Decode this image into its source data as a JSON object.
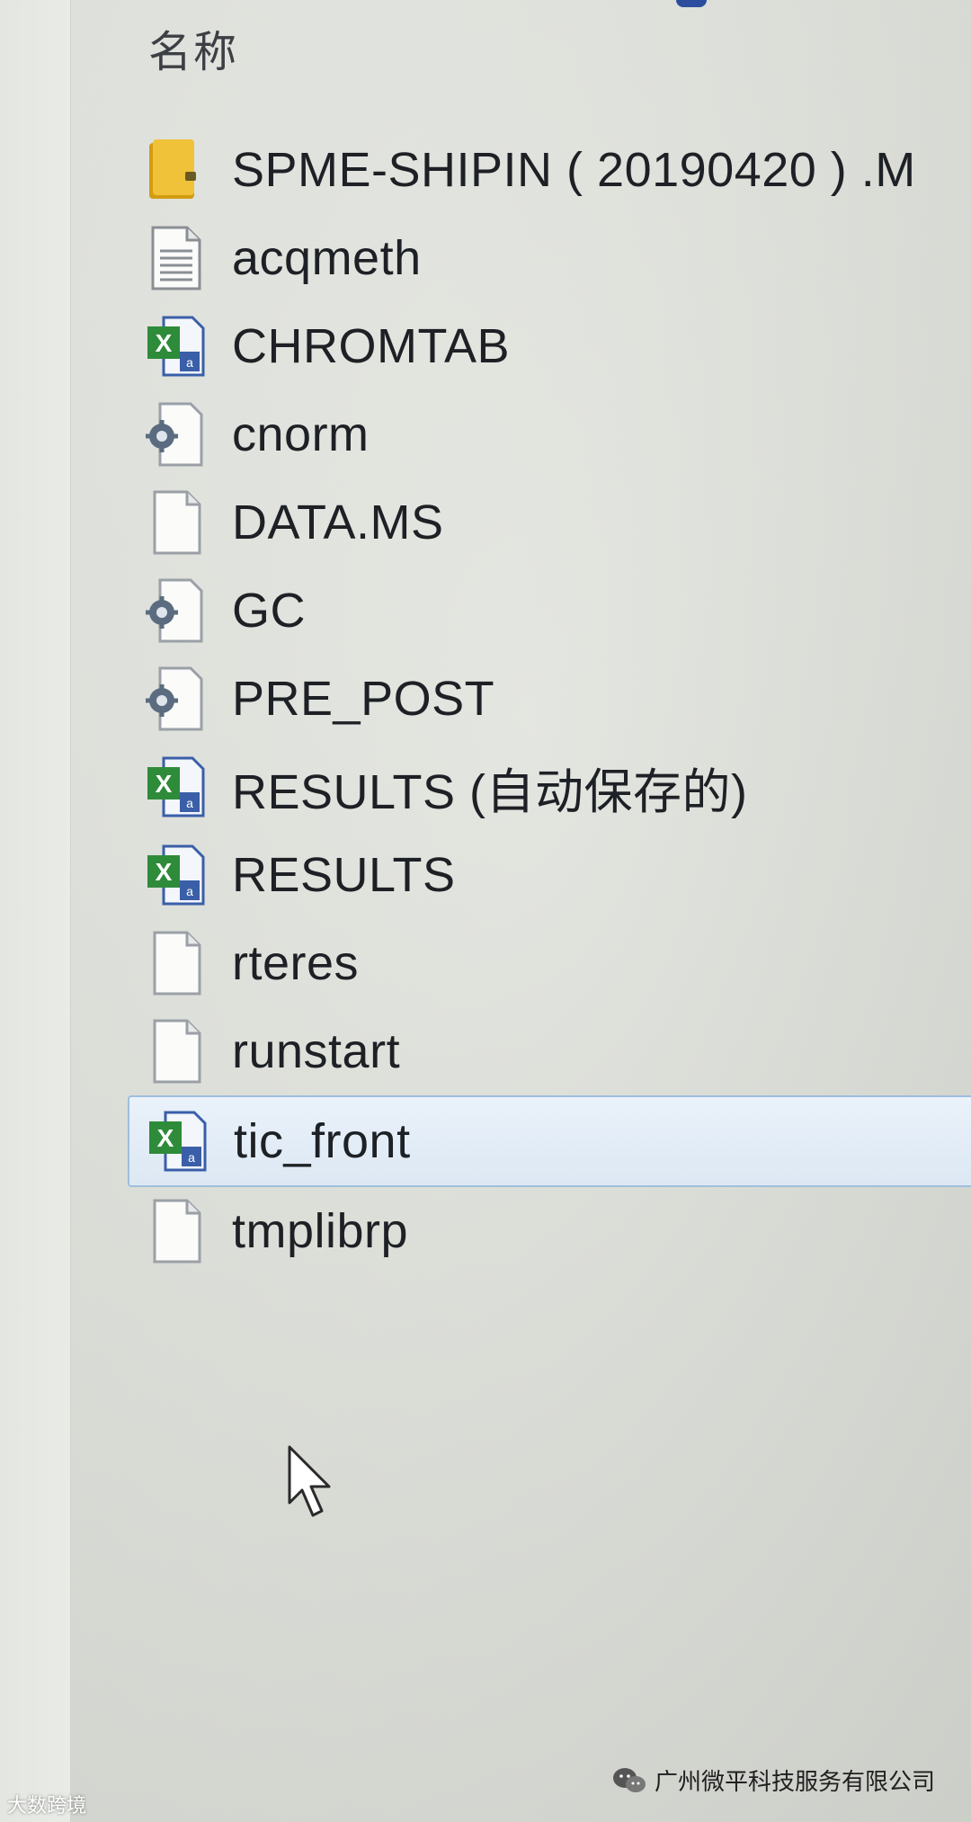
{
  "header": {
    "name_column": "名称"
  },
  "files": [
    {
      "name": "SPME-SHIPIN ( 20190420 ) .M",
      "icon": "folder-icon",
      "selected": false
    },
    {
      "name": "acqmeth",
      "icon": "text-document-icon",
      "selected": false
    },
    {
      "name": "CHROMTAB",
      "icon": "excel-file-icon",
      "selected": false
    },
    {
      "name": "cnorm",
      "icon": "settings-file-icon",
      "selected": false
    },
    {
      "name": "DATA.MS",
      "icon": "blank-file-icon",
      "selected": false
    },
    {
      "name": "GC",
      "icon": "settings-file-icon",
      "selected": false
    },
    {
      "name": "PRE_POST",
      "icon": "settings-file-icon",
      "selected": false
    },
    {
      "name": "RESULTS (自动保存的)",
      "icon": "excel-file-icon",
      "selected": false
    },
    {
      "name": "RESULTS",
      "icon": "excel-file-icon",
      "selected": false
    },
    {
      "name": "rteres",
      "icon": "blank-file-icon",
      "selected": false
    },
    {
      "name": "runstart",
      "icon": "blank-file-icon",
      "selected": false
    },
    {
      "name": "tic_front",
      "icon": "excel-file-icon",
      "selected": true
    },
    {
      "name": "tmplibrp",
      "icon": "blank-file-icon",
      "selected": false
    }
  ],
  "watermarks": {
    "left": "大数跨境",
    "right": "广州微平科技服务有限公司"
  },
  "colors": {
    "selection_border": "#9fbfdd",
    "selection_fill": "#dde8f4",
    "folder": "#e8b422",
    "excel_green": "#2e8b3a"
  }
}
